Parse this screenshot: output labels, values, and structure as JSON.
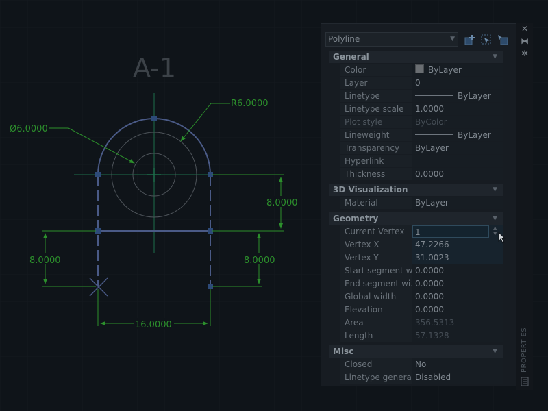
{
  "drawing": {
    "title": "A-1",
    "dimensions": {
      "radius": "R6.0000",
      "diameter": "Ø6.0000",
      "right_height": "8.0000",
      "left_lower_height": "8.0000",
      "right_lower_height": "8.0000",
      "bottom_width": "16.0000"
    }
  },
  "palette": {
    "selected_type": "Polyline",
    "strip_label": "PROPERTIES",
    "sections": {
      "general": {
        "title": "General",
        "rows": [
          {
            "label": "Color",
            "value": "ByLayer"
          },
          {
            "label": "Layer",
            "value": "0"
          },
          {
            "label": "Linetype",
            "value": "ByLayer"
          },
          {
            "label": "Linetype scale",
            "value": "1.0000"
          },
          {
            "label": "Plot style",
            "value": "ByColor"
          },
          {
            "label": "Lineweight",
            "value": "ByLayer"
          },
          {
            "label": "Transparency",
            "value": "ByLayer"
          },
          {
            "label": "Hyperlink",
            "value": ""
          },
          {
            "label": "Thickness",
            "value": "0.0000"
          }
        ]
      },
      "visualization": {
        "title": "3D Visualization",
        "rows": [
          {
            "label": "Material",
            "value": "ByLayer"
          }
        ]
      },
      "geometry": {
        "title": "Geometry",
        "rows": [
          {
            "label": "Current Vertex",
            "value": "1"
          },
          {
            "label": "Vertex X",
            "value": "47.2266"
          },
          {
            "label": "Vertex Y",
            "value": "31.0023"
          },
          {
            "label": "Start segment w...",
            "value": "0.0000"
          },
          {
            "label": "End segment wi...",
            "value": "0.0000"
          },
          {
            "label": "Global width",
            "value": "0.0000"
          },
          {
            "label": "Elevation",
            "value": "0.0000"
          },
          {
            "label": "Area",
            "value": "356.5313"
          },
          {
            "label": "Length",
            "value": "57.1328"
          }
        ]
      },
      "misc": {
        "title": "Misc",
        "rows": [
          {
            "label": "Closed",
            "value": "No"
          },
          {
            "label": "Linetype genera...",
            "value": "Disabled"
          }
        ]
      }
    }
  },
  "colors": {
    "background": "#0f1419",
    "polyline": "#4a5a86",
    "dimension": "#2c8f2c",
    "centerline": "#1d6e4a",
    "circle": "#4e545a"
  }
}
